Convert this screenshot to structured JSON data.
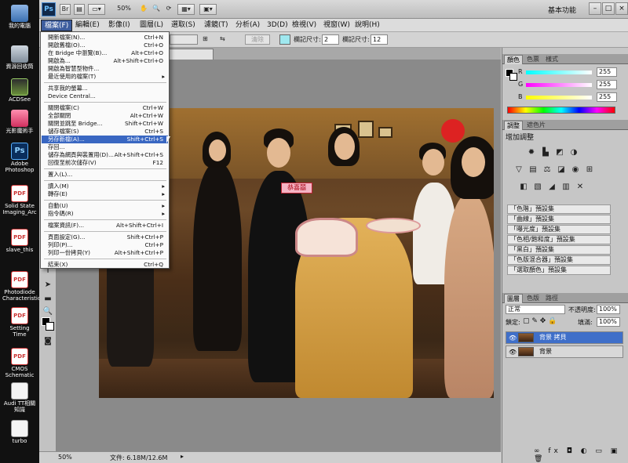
{
  "desktop": {
    "icons": [
      {
        "label": "我的電腦",
        "icon": "computer-icon"
      },
      {
        "label": "資源回收筒",
        "icon": "recycle-bin-icon"
      },
      {
        "label": "ACDSee",
        "icon": "acdsee-icon"
      },
      {
        "label": "光影魔術手",
        "icon": "photo-editor-icon"
      },
      {
        "label": "Adobe Photoshop",
        "icon": "photoshop-icon"
      },
      {
        "label": "Solid State Imaging_Arc",
        "icon": "pdf-icon"
      },
      {
        "label": "slave_this",
        "icon": "pdf-icon"
      },
      {
        "label": "Photodiode Characteristic",
        "icon": "pdf-icon"
      },
      {
        "label": "Setting Time",
        "icon": "pdf-icon"
      },
      {
        "label": "CMOS Schematic",
        "icon": "pdf-icon"
      },
      {
        "label": "Audi TT相關知識",
        "icon": "document-icon"
      },
      {
        "label": "turbo",
        "icon": "document-icon"
      }
    ]
  },
  "appbar": {
    "logo": "Ps",
    "zoom": "50%",
    "workspace": "基本功能",
    "window_controls": [
      "–",
      "□",
      "×"
    ]
  },
  "menubar": [
    "檔案(F)",
    "編輯(E)",
    "影像(I)",
    "圖層(L)",
    "選取(S)",
    "濾鏡(T)",
    "分析(A)",
    "3D(D)",
    "檢視(V)",
    "視窗(W)",
    "說明(H)"
  ],
  "options": {
    "clear_label": "清除",
    "width_label": "欄記尺寸:",
    "width_value": "2",
    "height_label": "欄記尺寸:",
    "height_value": "12"
  },
  "file_menu": {
    "items": [
      {
        "label": "開新檔案(N)...",
        "shortcut": "Ctrl+N"
      },
      {
        "label": "開啟舊檔(O)...",
        "shortcut": "Ctrl+O"
      },
      {
        "label": "在 Bridge 中瀏覽(B)...",
        "shortcut": "Alt+Ctrl+O"
      },
      {
        "label": "開啟為...",
        "shortcut": "Alt+Shift+Ctrl+O"
      },
      {
        "label": "開啟為智慧型物件...",
        "shortcut": ""
      },
      {
        "label": "最近使用的檔案(T)",
        "shortcut": "",
        "submenu": true
      },
      {
        "sep": true
      },
      {
        "label": "共享我的螢幕...",
        "shortcut": ""
      },
      {
        "label": "Device Central...",
        "shortcut": ""
      },
      {
        "sep": true
      },
      {
        "label": "關閉檔案(C)",
        "shortcut": "Ctrl+W"
      },
      {
        "label": "全部關閉",
        "shortcut": "Alt+Ctrl+W"
      },
      {
        "label": "關閉並跳至 Bridge...",
        "shortcut": "Shift+Ctrl+W"
      },
      {
        "label": "儲存檔案(S)",
        "shortcut": "Ctrl+S"
      },
      {
        "label": "另存新檔(A)...",
        "shortcut": "Shift+Ctrl+S",
        "highlight": true
      },
      {
        "label": "存回...",
        "shortcut": ""
      },
      {
        "label": "儲存為網頁與裝置用(D)...",
        "shortcut": "Alt+Shift+Ctrl+S"
      },
      {
        "label": "回復至前次儲存(V)",
        "shortcut": "F12"
      },
      {
        "sep": true
      },
      {
        "label": "置入(L)...",
        "shortcut": ""
      },
      {
        "sep": true
      },
      {
        "label": "讀入(M)",
        "shortcut": "",
        "submenu": true
      },
      {
        "label": "轉存(E)",
        "shortcut": "",
        "submenu": true
      },
      {
        "sep": true
      },
      {
        "label": "自動(U)",
        "shortcut": "",
        "submenu": true
      },
      {
        "label": "指令碼(R)",
        "shortcut": "",
        "submenu": true
      },
      {
        "sep": true
      },
      {
        "label": "檔案資訊(F)...",
        "shortcut": "Alt+Shift+Ctrl+I"
      },
      {
        "sep": true
      },
      {
        "label": "頁面設定(G)...",
        "shortcut": "Shift+Ctrl+P"
      },
      {
        "label": "列印(P)...",
        "shortcut": "Ctrl+P"
      },
      {
        "label": "列印一份拷貝(Y)",
        "shortcut": "Alt+Shift+Ctrl+P"
      },
      {
        "sep": true
      },
      {
        "label": "結束(X)",
        "shortcut": "Ctrl+Q"
      }
    ]
  },
  "document": {
    "tab_fragment": "*) ×",
    "photo_sign": "恭喜囍",
    "status_zoom": "50%",
    "status_doc": "文件: 6.18M/12.6M"
  },
  "color_panel": {
    "tabs": [
      "顏色",
      "色票",
      "樣式"
    ],
    "channels": [
      {
        "label": "R",
        "value": "255"
      },
      {
        "label": "G",
        "value": "255"
      },
      {
        "label": "B",
        "value": "255"
      }
    ]
  },
  "adjust_panel": {
    "tabs": [
      "調整",
      "遮色片"
    ],
    "title": "增加調整",
    "presets": [
      "「色階」預設集",
      "「曲線」預設集",
      "「曝光度」預設集",
      "「色相/飽和度」預設集",
      "「黑白」預設集",
      "「色版混合器」預設集",
      "「選取顏色」預設集"
    ]
  },
  "layers_panel": {
    "tabs": [
      "圖層",
      "色版",
      "路徑"
    ],
    "blend_mode": "正常",
    "opacity_label": "不透明度:",
    "opacity_value": "100%",
    "lock_label": "鎖定:",
    "fill_label": "填滿:",
    "fill_value": "100%",
    "layers": [
      {
        "name": "背景 拷貝",
        "selected": true
      },
      {
        "name": "背景",
        "selected": false
      }
    ]
  }
}
